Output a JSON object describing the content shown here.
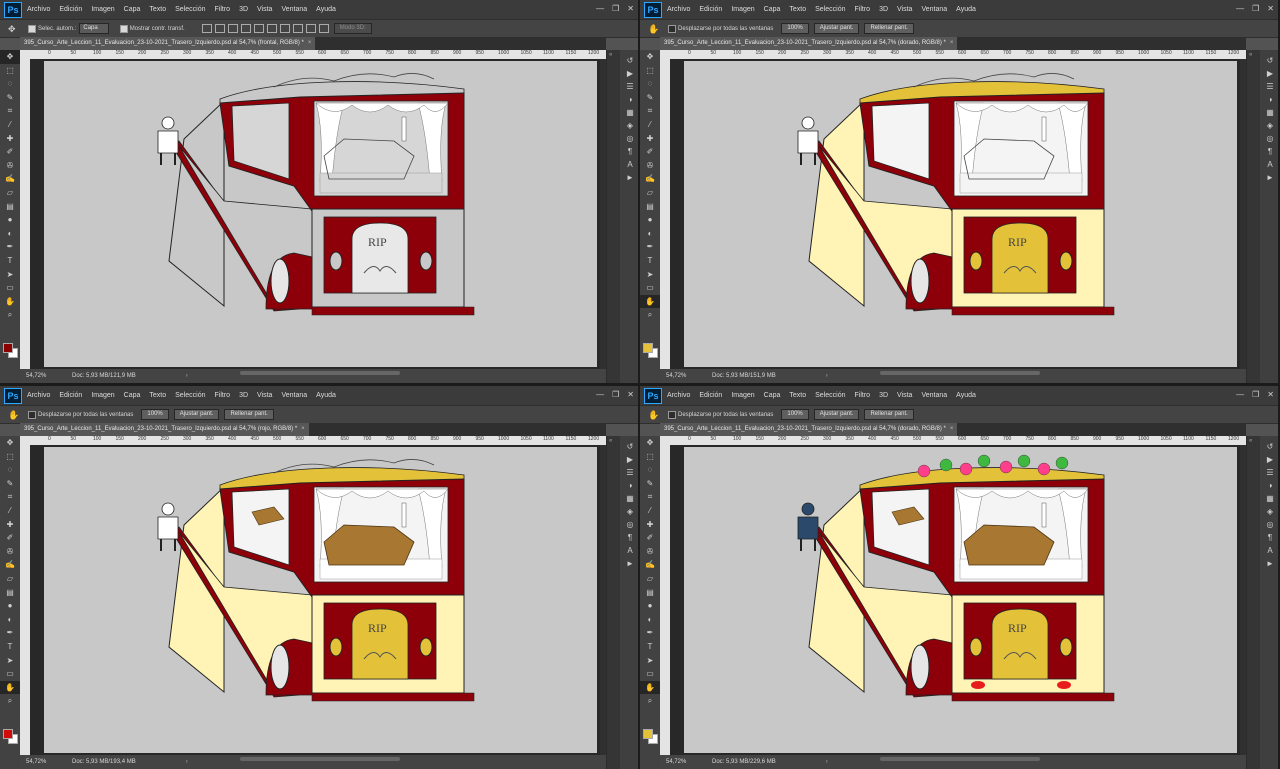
{
  "app": {
    "logo": "Ps"
  },
  "menu": [
    "Archivo",
    "Edición",
    "Imagen",
    "Capa",
    "Texto",
    "Selección",
    "Filtro",
    "3D",
    "Vista",
    "Ventana",
    "Ayuda"
  ],
  "window_controls": [
    "minimize-icon",
    "restore-icon",
    "close-icon"
  ],
  "options_move": {
    "auto_select_label": "Selec. autom.:",
    "auto_select_value": "Capa",
    "transform_label": "Mostrar contr. transf.",
    "mode3d_label": "Modo 3D:"
  },
  "options_hand": {
    "scroll_all_label": "Desplazarse por todas las ventanas",
    "zoom_btn": "100%",
    "fit_btn": "Ajustar pant.",
    "fill_btn": "Rellenar pant."
  },
  "ruler_ticks": [
    "0",
    "50",
    "100",
    "150",
    "200",
    "250",
    "300",
    "350",
    "400",
    "450",
    "500",
    "550",
    "600",
    "650",
    "700",
    "750",
    "800",
    "850",
    "900",
    "950",
    "1000",
    "1050",
    "1100",
    "1150",
    "1200"
  ],
  "panels": [
    {
      "doc_tab": "395_Curso_Arte_Leccion_11_Evaluacion_23-10-2021_Trasero_Izquierdo.psd al 54,7% (frontal, RGB/8) *",
      "zoom": "54,72%",
      "doc_size": "Doc: 5,93 MB/121,9 MB",
      "active_tool": "move",
      "fg_color": "#8b0000",
      "bg_color": "#ffffff"
    },
    {
      "doc_tab": "395_Curso_Arte_Leccion_11_Evaluacion_23-10-2021_Trasero_Izquierdo.psd al 54,7% (dorado, RGB/8) *",
      "zoom": "54,72%",
      "doc_size": "Doc: 5,93 MB/151,9 MB",
      "active_tool": "hand",
      "fg_color": "#e3c23a",
      "bg_color": "#ffffff"
    },
    {
      "doc_tab": "395_Curso_Arte_Leccion_11_Evaluacion_23-10-2021_Trasero_Izquierdo.psd al 54,7% (rojo, RGB/8) *",
      "zoom": "54,72%",
      "doc_size": "Doc: 5,93 MB/193,4 MB",
      "active_tool": "hand",
      "fg_color": "#d10a0a",
      "bg_color": "#ffffff"
    },
    {
      "doc_tab": "395_Curso_Arte_Leccion_11_Evaluacion_23-10-2021_Trasero_Izquierdo.psd al 54,7% (dorado, RGB/8) *",
      "zoom": "54,72%",
      "doc_size": "Doc: 5,93 MB/229,6 MB",
      "active_tool": "hand",
      "fg_color": "#e3c23a",
      "bg_color": "#ffffff"
    }
  ],
  "artwork": {
    "rip_text": "RIP",
    "colors": {
      "body_red": "#8e0009",
      "cream": "#fff3b5",
      "gold": "#e3c23a",
      "wood": "#a87832",
      "canvas_bg": "#c8c8c8",
      "pink": "#ff3f8c",
      "green": "#3fb83f",
      "light_red": "#e81c1c",
      "figure_blue": "#2b4a6b"
    },
    "stages": [
      {
        "cream": false,
        "gold": false,
        "coffin": false,
        "flowers": false,
        "figure_colored": false,
        "lights": false
      },
      {
        "cream": true,
        "gold": true,
        "coffin": false,
        "flowers": false,
        "figure_colored": false,
        "lights": false
      },
      {
        "cream": true,
        "gold": true,
        "coffin": true,
        "flowers": false,
        "figure_colored": false,
        "lights": false
      },
      {
        "cream": true,
        "gold": true,
        "coffin": true,
        "flowers": true,
        "figure_colored": true,
        "lights": true
      }
    ]
  },
  "tools": [
    "move-icon",
    "marquee-icon",
    "lasso-icon",
    "quick-select-icon",
    "crop-icon",
    "eyedropper-icon",
    "healing-icon",
    "brush-icon",
    "clone-icon",
    "history-brush-icon",
    "eraser-icon",
    "gradient-icon",
    "blur-icon",
    "dodge-icon",
    "pen-icon",
    "type-icon",
    "path-select-icon",
    "shape-icon",
    "hand-icon",
    "zoom-icon"
  ],
  "dock_icons": [
    "history-icon",
    "actions-icon",
    "properties-icon",
    "color-icon",
    "swatches-icon",
    "layers-icon",
    "channels-icon",
    "paragraph-icon",
    "character-icon",
    "play-icon"
  ]
}
